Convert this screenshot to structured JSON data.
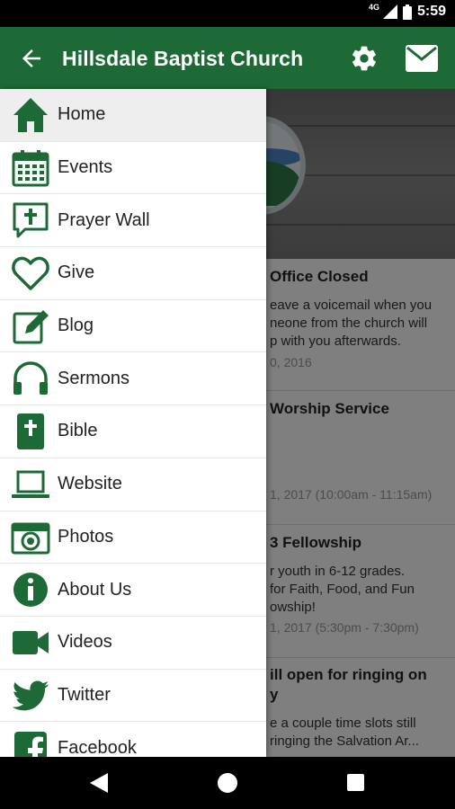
{
  "status_bar": {
    "network": "4G",
    "time": "5:59"
  },
  "app_bar": {
    "title": "Hillsdale Baptist Church"
  },
  "colors": {
    "brand_green": "#1e6a37",
    "icon_green": "#1e6a37"
  },
  "feed": [
    {
      "title": "Office Closed",
      "desc": "eave a voicemail when you\nneone from the church will\np with you afterwards.",
      "date": "0, 2016"
    },
    {
      "title": "Worship Service",
      "desc": "",
      "date": "1, 2017 (10:00am - 11:15am)"
    },
    {
      "title": "3 Fellowship",
      "desc": "r youth in 6-12 grades.\nfor Faith, Food, and Fun\nowship!",
      "date": "1, 2017 (5:30pm - 7:30pm)"
    },
    {
      "title": "ill open for ringing on\ny",
      "desc": "e a couple time slots still\nringing the Salvation Ar...",
      "date": ""
    }
  ],
  "drawer": {
    "items": [
      {
        "label": "Home",
        "icon": "home-icon",
        "active": true
      },
      {
        "label": "Events",
        "icon": "calendar-icon"
      },
      {
        "label": "Prayer Wall",
        "icon": "prayer-bubble-icon"
      },
      {
        "label": "Give",
        "icon": "heart-icon"
      },
      {
        "label": "Blog",
        "icon": "edit-icon"
      },
      {
        "label": "Sermons",
        "icon": "headphones-icon"
      },
      {
        "label": "Bible",
        "icon": "bible-icon"
      },
      {
        "label": "Website",
        "icon": "laptop-icon"
      },
      {
        "label": "Photos",
        "icon": "camera-icon"
      },
      {
        "label": "About Us",
        "icon": "info-icon"
      },
      {
        "label": "Videos",
        "icon": "video-camera-icon"
      },
      {
        "label": "Twitter",
        "icon": "twitter-icon"
      },
      {
        "label": "Facebook",
        "icon": "facebook-icon"
      }
    ]
  }
}
